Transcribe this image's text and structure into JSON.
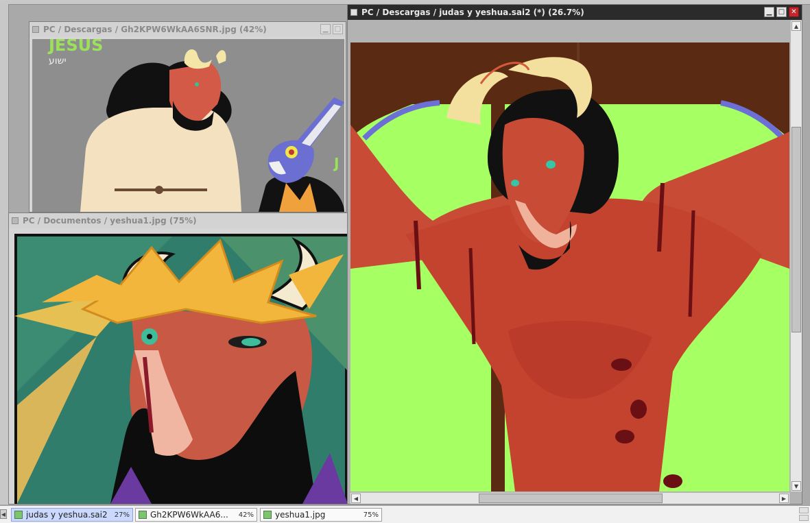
{
  "windows": {
    "gh2": {
      "title": "PC / Descargas / Gh2KPW6WkAA6SNR.jpg (42%)",
      "image": {
        "title_text": "JESUS",
        "hebrew_text": "ישוע",
        "partial_text": "J"
      }
    },
    "yeshua": {
      "title": "PC / Documentos / yeshua1.jpg (75%)"
    },
    "judas": {
      "title": "PC / Descargas / judas y yeshua.sai2 (*) (26.7%)"
    }
  },
  "window_controls": {
    "minimize_glyph": "▁",
    "maximize_glyph": "□",
    "close_glyph": "✕"
  },
  "taskbar": {
    "tabs": [
      {
        "name": "judas y yeshua.sai2",
        "percent": "27%"
      },
      {
        "name": "Gh2KPW6WkAA6...",
        "percent": "42%"
      },
      {
        "name": "yeshua1.jpg",
        "percent": "75%"
      }
    ]
  },
  "colors": {
    "active_titlebar": "#2b2b2b",
    "inactive_titlebar": "#d3d3d3",
    "close_button": "#c1272d",
    "active_tab": "#ccd9ff",
    "lime_background": "#a6ff63"
  },
  "icons": {
    "window": "window-icon",
    "tab_file": "image-file-icon"
  }
}
